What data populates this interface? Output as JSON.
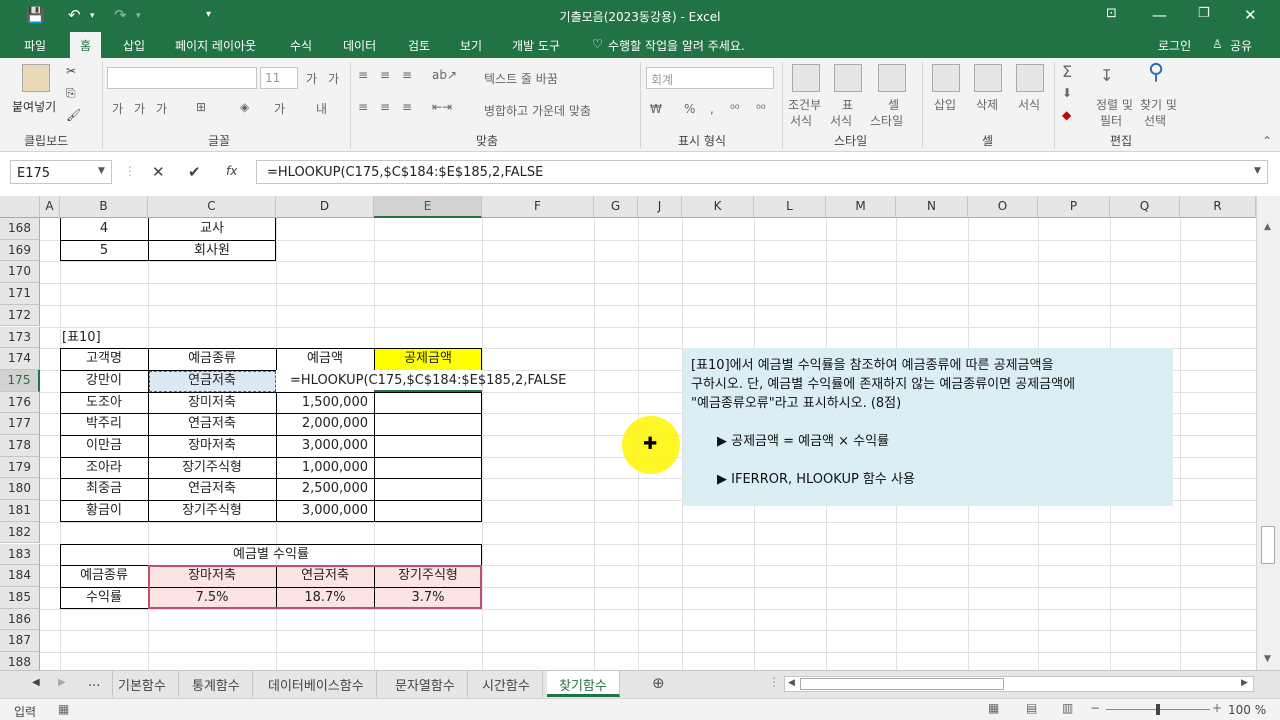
{
  "window": {
    "title": "기출모음(2023동강용) - Excel",
    "login": "로그인",
    "share": "공유"
  },
  "tabs": [
    "파일",
    "홈",
    "삽입",
    "페이지 레이아웃",
    "수식",
    "데이터",
    "검토",
    "보기",
    "개발 도구"
  ],
  "tell_me": "수행할 작업을 알려 주세요.",
  "ribbon": {
    "clipboard": {
      "label": "클립보드",
      "paste": "붙여넣기"
    },
    "font": {
      "label": "글꼴",
      "size": "11"
    },
    "align": {
      "label": "맞춤",
      "wrap": "텍스트 줄 바꿈",
      "merge": "병합하고 가운데 맞춤"
    },
    "number": {
      "label": "표시 형식",
      "format": "회계"
    },
    "styles": {
      "label": "스타일",
      "cond": "조건부",
      "cond2": "서식",
      "table": "표",
      "table2": "서식",
      "cell": "셀",
      "cell2": "스타일"
    },
    "cells": {
      "label": "셀",
      "insert": "삽입",
      "delete": "삭제",
      "format": "서식"
    },
    "editing": {
      "label": "편집",
      "sort": "정렬 및",
      "sort2": "필터",
      "find": "찾기 및",
      "find2": "선택"
    }
  },
  "formula_bar": {
    "name_box": "E175",
    "formula": "=HLOOKUP(C175,$C$184:$E$185,2,FALSE"
  },
  "columns": [
    "A",
    "B",
    "C",
    "D",
    "E",
    "F",
    "G",
    "J",
    "K",
    "L",
    "M",
    "N",
    "O",
    "P",
    "Q",
    "R"
  ],
  "rows": [
    "168",
    "169",
    "170",
    "171",
    "172",
    "173",
    "174",
    "175",
    "176",
    "177",
    "178",
    "179",
    "180",
    "181",
    "182",
    "183",
    "184",
    "185",
    "186",
    "187",
    "188"
  ],
  "top_rows": [
    {
      "b": "4",
      "c": "교사"
    },
    {
      "b": "5",
      "c": "회사원"
    }
  ],
  "table10": {
    "caption": "[표10]",
    "headers": [
      "고객명",
      "예금종류",
      "예금액",
      "공제금액"
    ],
    "editing_formula": "=HLOOKUP(C175,$C$184:$E$185,2,FALSE",
    "rows": [
      {
        "name": "강만이",
        "type": "연금저축",
        "amount": ""
      },
      {
        "name": "도조아",
        "type": "장미저축",
        "amount": "1,500,000"
      },
      {
        "name": "박주리",
        "type": "연금저축",
        "amount": "2,000,000"
      },
      {
        "name": "이만금",
        "type": "장마저축",
        "amount": "3,000,000"
      },
      {
        "name": "조아라",
        "type": "장기주식형",
        "amount": "1,000,000"
      },
      {
        "name": "최중금",
        "type": "연금저축",
        "amount": "2,500,000"
      },
      {
        "name": "황금이",
        "type": "장기주식형",
        "amount": "3,000,000"
      }
    ]
  },
  "rate_table": {
    "title": "예금별 수익률",
    "row_label_1": "예금종류",
    "row_label_2": "수익률",
    "types": [
      "장마저축",
      "연금저축",
      "장기주식형"
    ],
    "rates": [
      "7.5%",
      "18.7%",
      "3.7%"
    ]
  },
  "note": {
    "line1": "[표10]에서 예금별 수익률을 참조하여 예금종류에 따른 공제금액을",
    "line2": "구하시오. 단, 예금별 수익률에 존재하지 않는 예금종류이면 공제금액에",
    "line3": "\"예금종류오류\"라고 표시하시오. (8점)",
    "bullet1": "▶ 공제금액 = 예금액 × 수익률",
    "bullet2": "▶ IFERROR, HLOOKUP 함수 사용"
  },
  "sheet_tabs": [
    "...",
    "기본함수",
    "통계함수",
    "데이터베이스함수",
    "문자열함수",
    "시간함수",
    "찾기함수"
  ],
  "status": {
    "mode": "입력",
    "zoom": "100 %"
  },
  "colors": {
    "excel_green": "#217346",
    "header_yellow": "#ffff00",
    "rate_pink": "#fce4e4",
    "note_bg": "#daeef3"
  }
}
